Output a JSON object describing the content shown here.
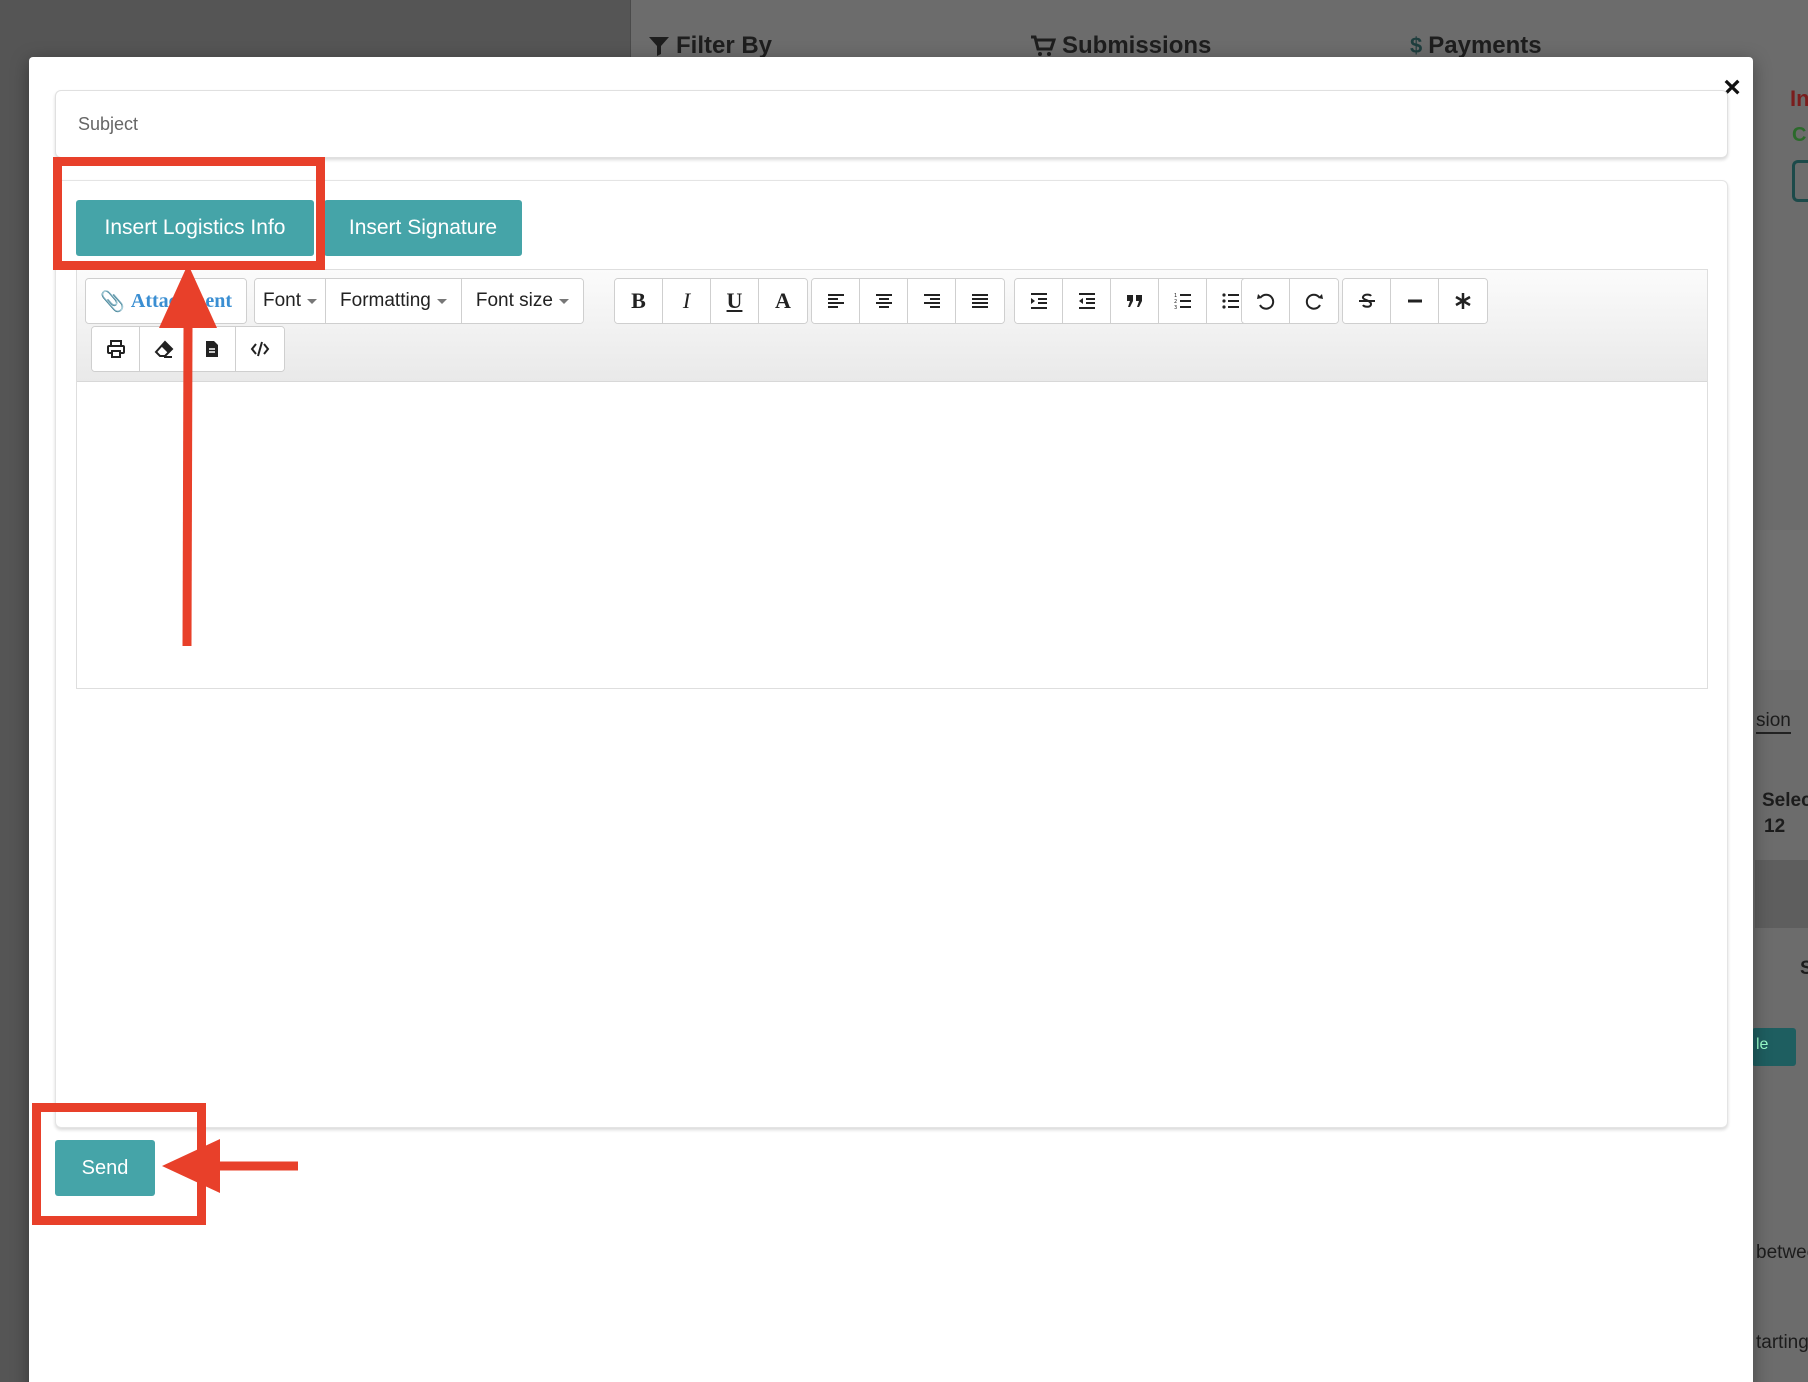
{
  "background": {
    "tabs": [
      {
        "icon": "filter-icon",
        "label": "Filter By"
      },
      {
        "icon": "cart-icon",
        "label": "Submissions"
      },
      {
        "icon": "dollar-icon",
        "label": "Payments"
      }
    ],
    "right_fragments": {
      "red": "In",
      "green": "C",
      "sion": "sion",
      "selec": "Selec",
      "twelve": "12",
      "s": "S",
      "teal": "le",
      "betwee": "betwee",
      "tarting": "tarting"
    }
  },
  "modal": {
    "close_label": "×",
    "subject_placeholder": "Subject",
    "insert_logistics_label": "Insert Logistics Info",
    "insert_signature_label": "Insert Signature",
    "toolbar": {
      "attachment_label": "Attachment",
      "font_label": "Font",
      "formatting_label": "Formatting",
      "font_size_label": "Font size",
      "bold": "B",
      "italic": "I",
      "underline": "U",
      "color": "A"
    },
    "send_label": "Send"
  },
  "colors": {
    "teal": "#45a4a8",
    "annotation_red": "#e8402a",
    "link_blue": "#3a8ed2"
  }
}
